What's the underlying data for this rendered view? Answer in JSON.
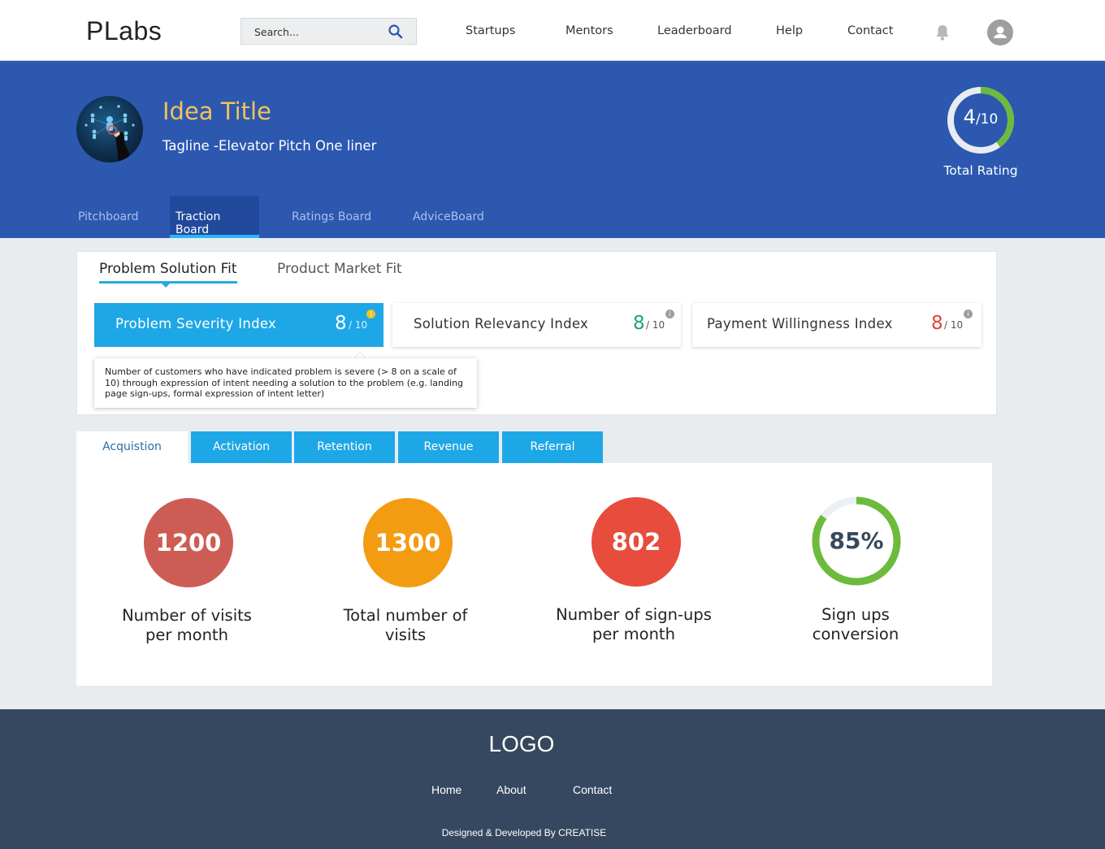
{
  "header": {
    "brand": "PLabs",
    "search_placeholder": "Search...",
    "nav": [
      "Startups",
      "Mentors",
      "Leaderboard",
      "Help",
      "Contact"
    ]
  },
  "idea": {
    "title": "Idea Title",
    "tagline": "Tagline  -Elevator Pitch One liner",
    "rating": {
      "value": "4",
      "out_of": "/10",
      "label": "Total Rating",
      "fraction": 0.4
    },
    "tabs": [
      "Pitchboard",
      "Traction Board",
      "Ratings Board",
      "AdviceBoard"
    ],
    "active_tab": "Traction Board"
  },
  "fit": {
    "tabs": [
      "Problem Solution Fit",
      "Product Market Fit"
    ],
    "active_tab": "Problem Solution Fit",
    "indices": [
      {
        "label": "Problem Severity Index",
        "score": "8",
        "out_of": "/ 10",
        "color": "#ffffff"
      },
      {
        "label": "Solution Relevancy Index",
        "score": "8",
        "out_of": "/ 10",
        "color": "#1fa37c"
      },
      {
        "label": "Payment Willingness Index",
        "score": "8",
        "out_of": "/ 10",
        "color": "#e2453c"
      }
    ],
    "tooltip": "Number of customers who have indicated problem is severe (> 8 on a scale of 10) through expression of intent needing a solution to the problem (e.g. landing page sign-ups, formal expression of intent letter)"
  },
  "metrics": {
    "tabs": [
      "Acquistion",
      "Activation",
      "Retention",
      "Revenue",
      "Referral"
    ],
    "active_tab": "Acquistion",
    "items": [
      {
        "value": "1200",
        "label_line1": "Number of visits",
        "label_line2": "per month",
        "color": "#cd5d54"
      },
      {
        "value": "1300",
        "label_line1": "Total number of",
        "label_line2": "visits",
        "color": "#f39c12"
      },
      {
        "value": "802",
        "label_line1": "Number of sign-ups",
        "label_line2": "per month",
        "color": "#e74c3c"
      },
      {
        "value": "85%",
        "label_line1": "Sign ups",
        "label_line2": "conversion",
        "color": "#6cbb3c",
        "fraction": 0.85
      }
    ]
  },
  "footer": {
    "logo": "LOGO",
    "links": [
      "Home",
      "About",
      "Contact"
    ],
    "credits": "Designed & Developed By CREATISE"
  }
}
